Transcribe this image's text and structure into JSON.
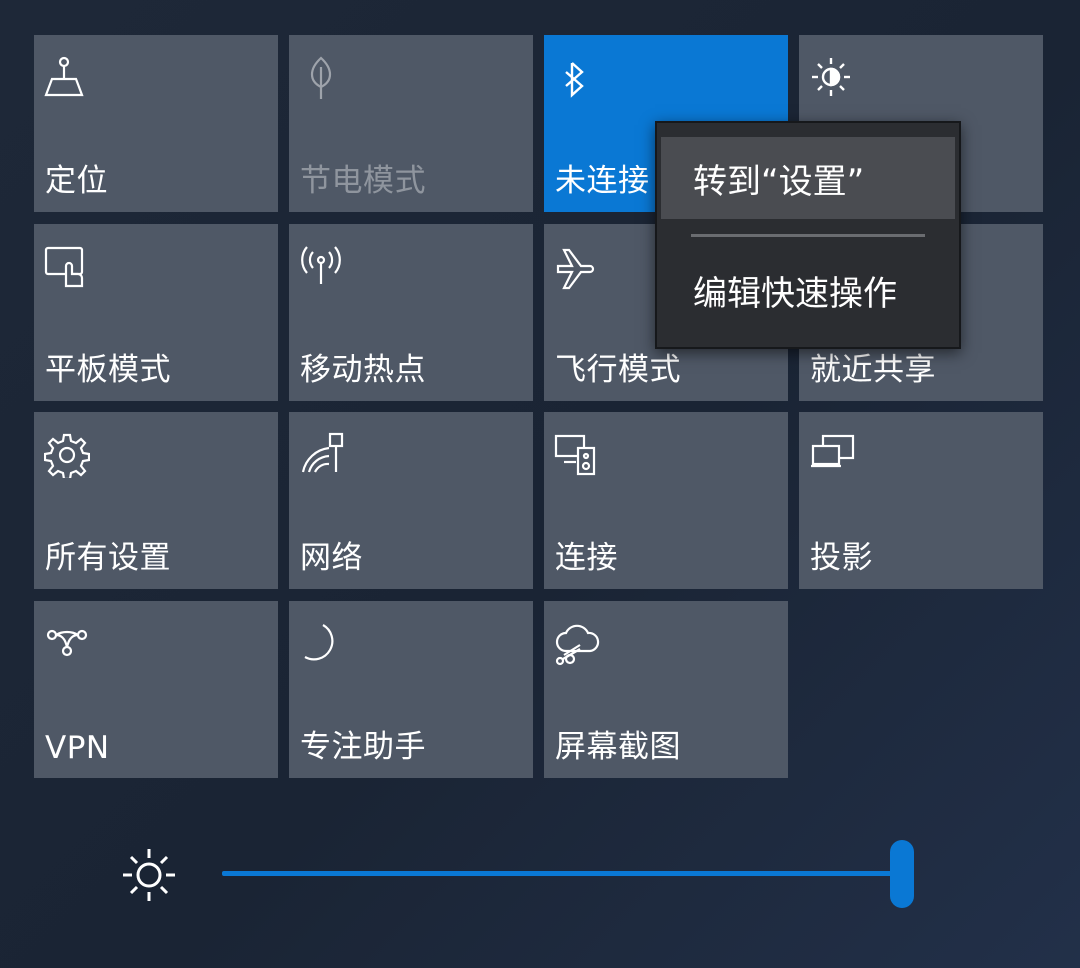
{
  "tiles": [
    {
      "label": "定位",
      "icon": "location-icon"
    },
    {
      "label": "节电模式",
      "icon": "leaf-icon"
    },
    {
      "label": "未连接",
      "icon": "bluetooth-icon"
    },
    {
      "label": "",
      "icon": "brightness-sun-icon"
    },
    {
      "label": "平板模式",
      "icon": "tablet-mode-icon"
    },
    {
      "label": "移动热点",
      "icon": "hotspot-icon"
    },
    {
      "label": "飞行模式",
      "icon": "airplane-icon"
    },
    {
      "label": "就近共享",
      "icon": "nearby-share-icon"
    },
    {
      "label": "所有设置",
      "icon": "gear-icon"
    },
    {
      "label": "网络",
      "icon": "network-icon"
    },
    {
      "label": "连接",
      "icon": "connect-icon"
    },
    {
      "label": "投影",
      "icon": "project-icon"
    },
    {
      "label": "VPN",
      "icon": "vpn-icon"
    },
    {
      "label": "专注助手",
      "icon": "moon-icon"
    },
    {
      "label": "屏幕截图",
      "icon": "snip-icon"
    }
  ],
  "context_menu": {
    "item1": "转到“设置”",
    "item2": "编辑快速操作"
  },
  "brightness": {
    "icon": "sun-icon",
    "value": 0.986
  },
  "colors": {
    "accent": "#0a78d4",
    "tile": "#4f5866",
    "menu": "#2b2d31"
  }
}
